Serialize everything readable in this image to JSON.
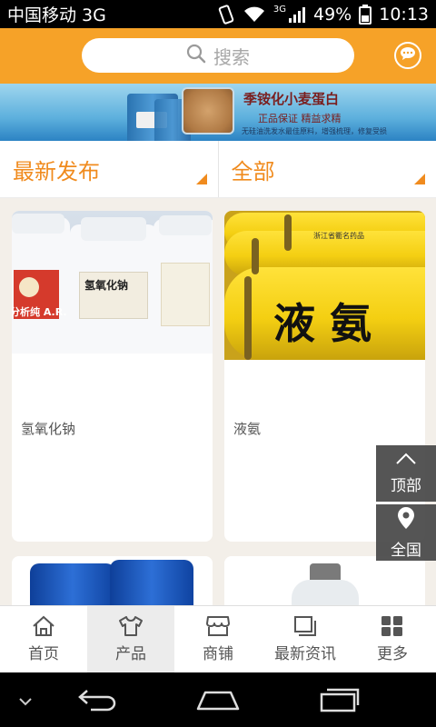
{
  "status_bar": {
    "carrier": "中国移动 3G",
    "network": "3G",
    "battery": "49%",
    "time": "10:13"
  },
  "header": {
    "search_placeholder": "搜索",
    "accent_color": "#f6a228"
  },
  "banner": {
    "title": "季铵化小麦蛋白",
    "subtitle": "正品保证  精益求精",
    "tagline": "无硅油洗发水最佳原料，增强梳理，修复受损"
  },
  "filters": [
    {
      "label": "最新发布"
    },
    {
      "label": "全部"
    }
  ],
  "products": [
    {
      "name": "氢氧化钠",
      "image_label": "氢氧化钠",
      "brand_label": "分析纯 A.R."
    },
    {
      "name": "液氨",
      "image_text": "液 氨",
      "tank_label": "浙江省衢名药品"
    },
    {
      "name": ""
    },
    {
      "name": ""
    }
  ],
  "floating": {
    "top_label": "顶部",
    "region_label": "全国"
  },
  "bottom_nav": [
    {
      "label": "首页",
      "icon": "home-icon",
      "active": false
    },
    {
      "label": "产品",
      "icon": "shirt-icon",
      "active": true
    },
    {
      "label": "商铺",
      "icon": "shop-icon",
      "active": false
    },
    {
      "label": "最新资讯",
      "icon": "news-icon",
      "active": false
    },
    {
      "label": "更多",
      "icon": "grid-icon",
      "active": false
    }
  ]
}
